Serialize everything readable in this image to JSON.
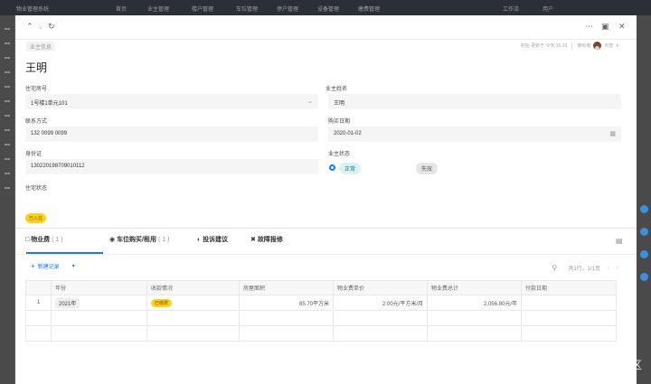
{
  "background_app": {
    "app_name": "物业管理系统",
    "nav": [
      "首页",
      "业主管理",
      "楼户管理",
      "车位管理",
      "停户管理",
      "设备管理",
      "缴费管理"
    ],
    "right_items": [
      "工作流",
      "用户"
    ]
  },
  "modal": {
    "record_tag": "业主信息",
    "meta_text": "初始 更新于 今天 15:33",
    "owner_label": "拥有者",
    "owner_name": "刘智",
    "title": "王明"
  },
  "fields": {
    "room_label": "住宅房号",
    "room_value": "1号楼1单元101",
    "owner_name_label": "业主姓名",
    "owner_name_value": "王明",
    "contact_label": "联系方式",
    "contact_value": "132 0099 0099",
    "purchase_date_label": "购买日期",
    "purchase_date_value": "2020-01-02",
    "id_label": "身份证",
    "id_value": "130220198709010112",
    "owner_status_label": "业主状态",
    "owner_status_active": "正常",
    "owner_status_inactive": "失效",
    "house_status_label": "住宅状态",
    "house_status_value": "已入住"
  },
  "tabs": [
    {
      "label": "物业费",
      "count": "( 1 )",
      "icon": "list-icon"
    },
    {
      "label": "车位购买/租用",
      "count": "( 1 )",
      "icon": "car-icon"
    },
    {
      "label": "投诉建议",
      "count": "",
      "icon": "chat-icon"
    },
    {
      "label": "故障报修",
      "count": "",
      "icon": "wrench-icon"
    }
  ],
  "toolbar": {
    "add_label": "新建记录",
    "pagination": "共1行，1/1页"
  },
  "table": {
    "headers": [
      "年份",
      "收款情况",
      "房屋面积",
      "物业费单价",
      "物业费总计",
      "付款日期"
    ],
    "rows": [
      {
        "index": "1",
        "year": "2021年",
        "pay_status": "已缴费",
        "area": "85.70平方米",
        "unit_price": "2.00元/平方米/月",
        "total": "2,056.80元/年",
        "pay_date": ""
      }
    ]
  },
  "watermark": "@稀土掘金技术社区",
  "colors": {
    "accent": "#1677ff",
    "status_yellow": "#ffd21a"
  }
}
